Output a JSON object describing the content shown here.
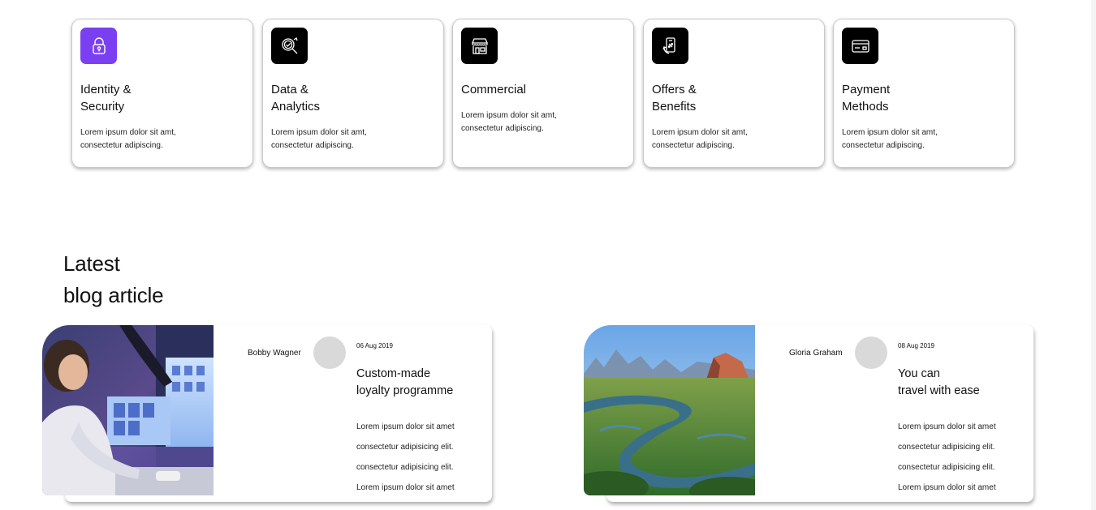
{
  "features": [
    {
      "title": "Identity &\nSecurity",
      "description": "Lorem ipsum dolor sit amt,\nconsectetur adipiscing.",
      "icon": "lock-icon",
      "icon_bg": "#7b3ff2"
    },
    {
      "title": "Data &\nAnalytics",
      "description": "Lorem ipsum dolor sit amt,\nconsectetur adipiscing.",
      "icon": "analytics-magnifier-icon",
      "icon_bg": "#000000"
    },
    {
      "title": "Commercial",
      "description": "Lorem ipsum dolor sit amt,\nconsectetur adipiscing.",
      "icon": "storefront-icon",
      "icon_bg": "#000000"
    },
    {
      "title": "Offers &\nBenefits",
      "description": "Lorem ipsum dolor sit amt,\nconsectetur adipiscing.",
      "icon": "mobile-offer-icon",
      "icon_bg": "#000000"
    },
    {
      "title": "Payment\nMethods",
      "description": "Lorem ipsum dolor sit amt,\nconsectetur adipiscing.",
      "icon": "credit-card-icon",
      "icon_bg": "#000000"
    }
  ],
  "blog_section": {
    "title": "Latest\nblog article"
  },
  "articles": [
    {
      "author": "Bobby Wagner",
      "date": "06 Aug 2019",
      "title": "Custom-made\nloyalty programme",
      "lines": [
        "Lorem ipsum dolor sit amet",
        "consectetur adipisicing elit.",
        "consectetur adipisicing elit.",
        "Lorem ipsum dolor sit amet"
      ],
      "image": "woman-at-computer-photo"
    },
    {
      "author": "Gloria Graham",
      "date": "08 Aug 2019",
      "title": "You can\ntravel with ease",
      "lines": [
        "Lorem ipsum dolor sit amet",
        "consectetur adipisicing elit.",
        "consectetur adipisicing elit.",
        "Lorem ipsum dolor sit amet"
      ],
      "image": "river-landscape-photo"
    }
  ],
  "colors": {
    "accent": "#7b3ff2",
    "avatar_placeholder": "#d9d9d9"
  }
}
